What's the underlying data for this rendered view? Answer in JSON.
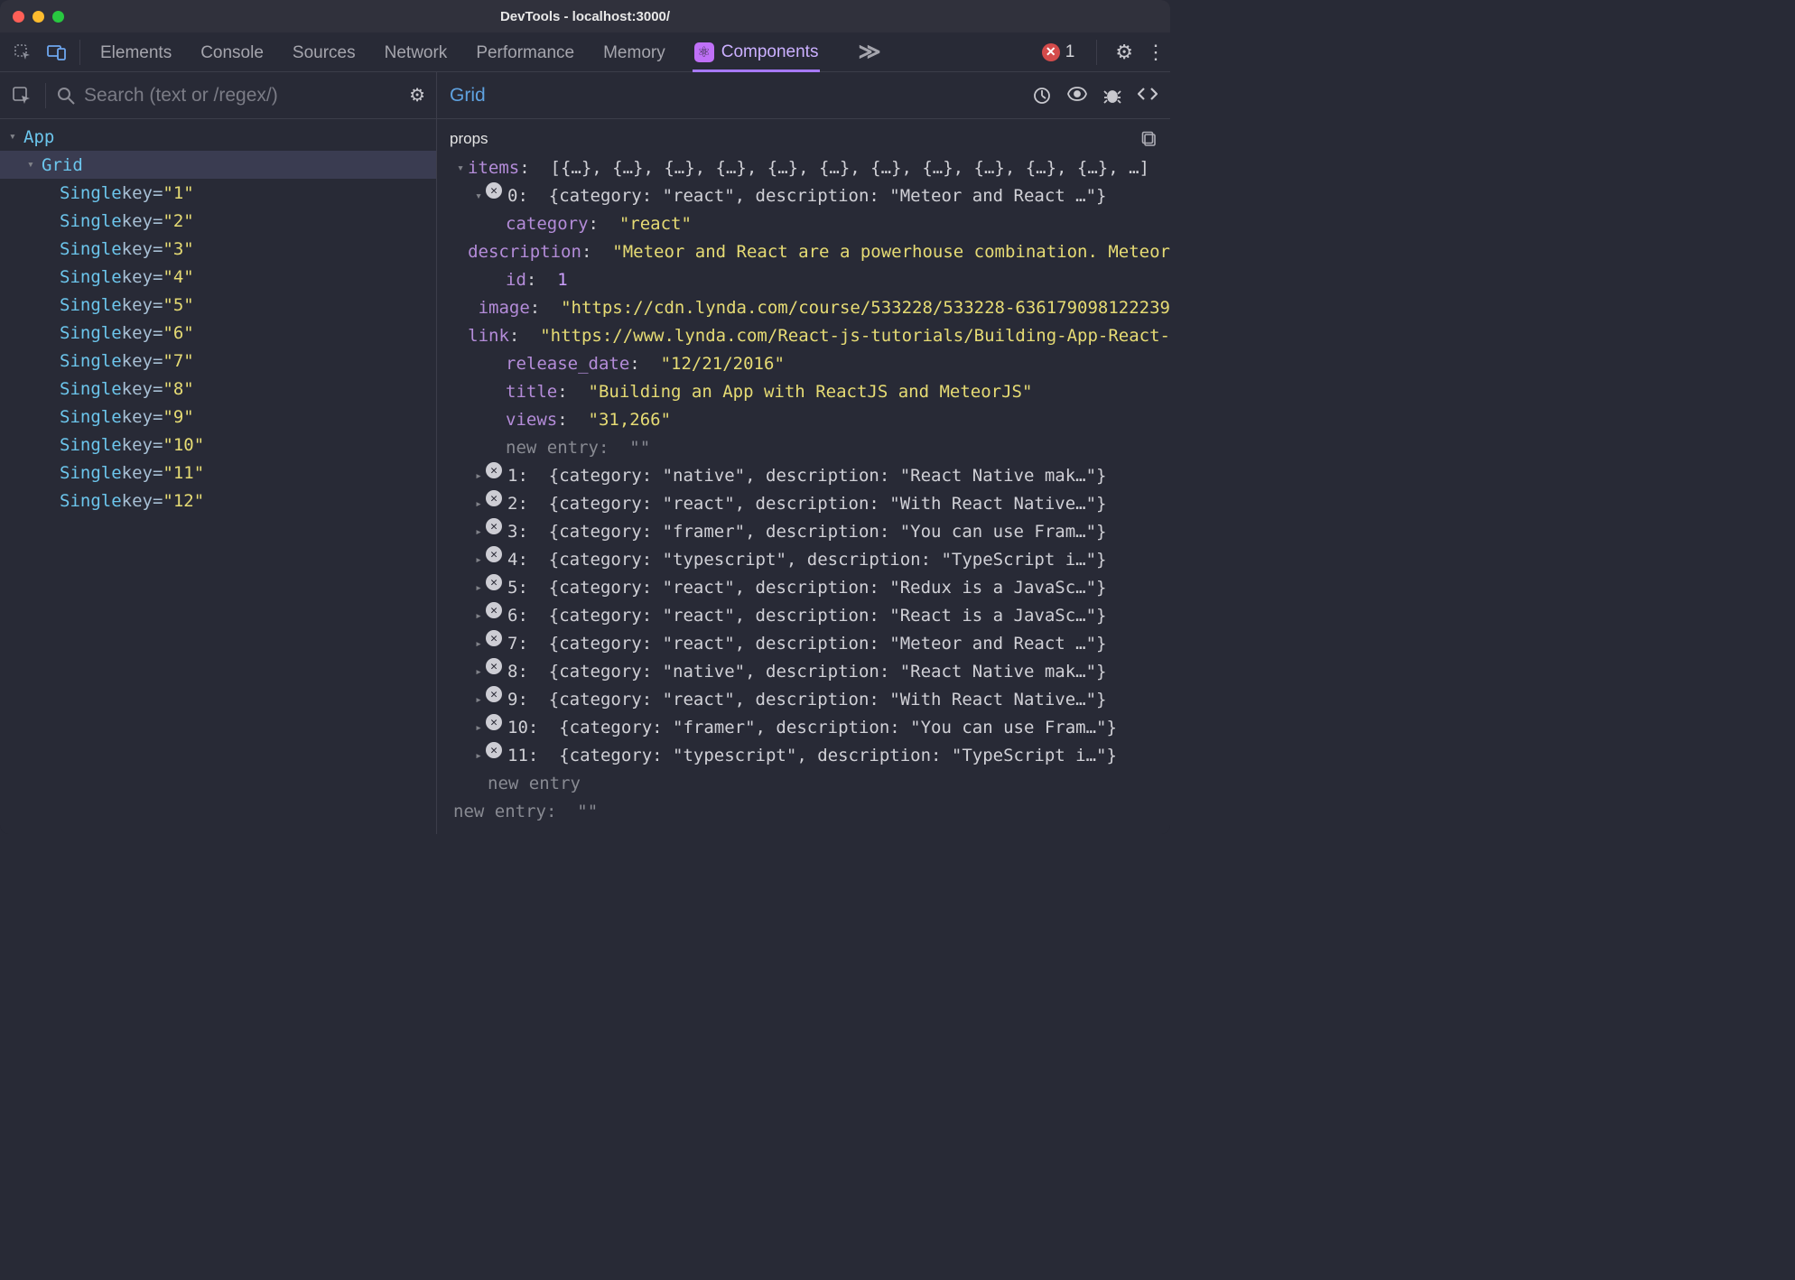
{
  "window": {
    "title": "DevTools - localhost:3000/"
  },
  "tabs": {
    "items": [
      "Elements",
      "Console",
      "Sources",
      "Network",
      "Performance",
      "Memory"
    ],
    "react_tab": "Components",
    "more": "≫",
    "error_count": "1"
  },
  "left": {
    "search_placeholder": "Search (text or /regex/)",
    "tree": {
      "app": "App",
      "grid": "Grid",
      "single_label": "Single",
      "key_label": "key",
      "singles": [
        "1",
        "2",
        "3",
        "4",
        "5",
        "6",
        "7",
        "8",
        "9",
        "10",
        "11",
        "12"
      ]
    }
  },
  "right": {
    "selected": "Grid",
    "section": "props",
    "items_key": "items",
    "items_summary": "[{…}, {…}, {…}, {…}, {…}, {…}, {…}, {…}, {…}, {…}, {…}, …]",
    "expanded": {
      "index": "0",
      "summary": "{category: \"react\", description: \"Meteor and React …\"}",
      "fields": {
        "category": {
          "k": "category",
          "v": "\"react\"",
          "t": "str"
        },
        "description": {
          "k": "description",
          "v": "\"Meteor and React are a powerhouse combination. Meteor",
          "t": "str"
        },
        "id": {
          "k": "id",
          "v": "1",
          "t": "num"
        },
        "image": {
          "k": "image",
          "v": "\"https://cdn.lynda.com/course/533228/533228-636179098122239",
          "t": "str"
        },
        "link": {
          "k": "link",
          "v": "\"https://www.lynda.com/React-js-tutorials/Building-App-React-",
          "t": "str"
        },
        "release_date": {
          "k": "release_date",
          "v": "\"12/21/2016\"",
          "t": "str"
        },
        "title": {
          "k": "title",
          "v": "\"Building an App with ReactJS and MeteorJS\"",
          "t": "str"
        },
        "views": {
          "k": "views",
          "v": "\"31,266\"",
          "t": "str"
        }
      },
      "new_entry_label": "new entry",
      "new_entry_value": "\"\""
    },
    "collapsed": [
      {
        "i": "1",
        "s": "{category: \"native\", description: \"React Native mak…\"}"
      },
      {
        "i": "2",
        "s": "{category: \"react\", description: \"With React Native…\"}"
      },
      {
        "i": "3",
        "s": "{category: \"framer\", description: \"You can use Fram…\"}"
      },
      {
        "i": "4",
        "s": "{category: \"typescript\", description: \"TypeScript i…\"}"
      },
      {
        "i": "5",
        "s": "{category: \"react\", description: \"Redux is a JavaSc…\"}"
      },
      {
        "i": "6",
        "s": "{category: \"react\", description: \"React is a JavaSc…\"}"
      },
      {
        "i": "7",
        "s": "{category: \"react\", description: \"Meteor and React …\"}"
      },
      {
        "i": "8",
        "s": "{category: \"native\", description: \"React Native mak…\"}"
      },
      {
        "i": "9",
        "s": "{category: \"react\", description: \"With React Native…\"}"
      },
      {
        "i": "10",
        "s": "{category: \"framer\", description: \"You can use Fram…\"}"
      },
      {
        "i": "11",
        "s": "{category: \"typescript\", description: \"TypeScript i…\"}"
      }
    ],
    "inner_new_entry": "new entry",
    "outer_new_entry_label": "new entry",
    "outer_new_entry_value": "\"\""
  }
}
